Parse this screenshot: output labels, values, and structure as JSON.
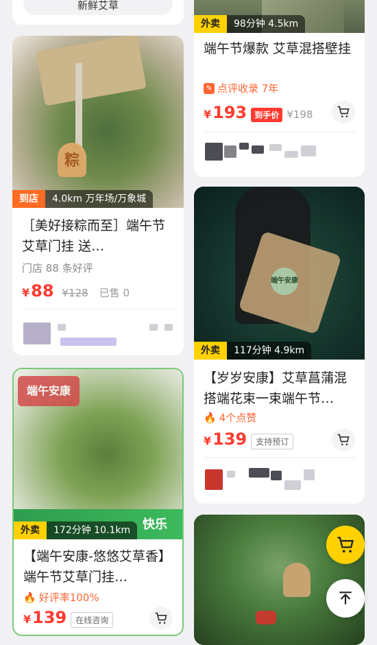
{
  "cards": [
    {
      "top_snippet": "新鲜艾草"
    },
    {
      "badge_type": "外卖",
      "badge_info": "98分钟  4.5km",
      "title": "端午节爆款 艾草混搭壁挂",
      "highlight": "点评收录 7年",
      "price": "193",
      "price_tag": "到手价",
      "orig_price": "¥198"
    },
    {
      "badge_type": "到店",
      "badge_info": "4.0km 万年场/万象城",
      "title": "［美好接粽而至］端午节艾草门挂  送…",
      "sub": "门店 88 条好评",
      "price": "88",
      "orig_price": "¥128",
      "sold": "已售 0",
      "image_text": "粽"
    },
    {
      "badge_type": "外卖",
      "badge_info": "117分钟  4.9km",
      "title": "【岁岁安康】艾草菖蒲混搭端花束一束端午节…",
      "highlight": "4个点赞",
      "price": "139",
      "price_tag": "支持预订",
      "image_text": "端午安康"
    },
    {
      "badge_type": "外卖",
      "badge_info": "172分钟  10.1km",
      "title": "【端午安康-悠悠艾草香】端午节艾草门挂…",
      "highlight": "好评率100%",
      "price": "139",
      "price_tag": "在线咨询",
      "image_text": "端午安康",
      "image_sub": "快乐"
    },
    {
      "badge_type": "",
      "title": ""
    }
  ],
  "currency": "¥",
  "icons": {
    "cart": "cart-icon",
    "top": "back-to-top-icon",
    "flame": "flame-icon",
    "review": "review-icon"
  },
  "colors": {
    "accent_red": "#ff3b30",
    "accent_orange": "#ff6633",
    "badge_yellow": "#ffd100",
    "fab_yellow": "#ffd100"
  }
}
